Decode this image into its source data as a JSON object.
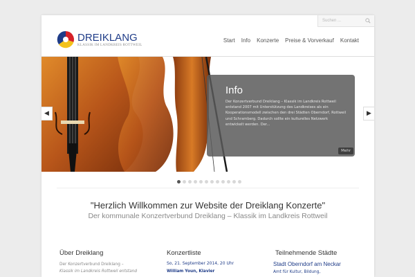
{
  "search": {
    "placeholder": "Suchen ..."
  },
  "logo": {
    "name": "DREIKLANG",
    "subtitle": "KLASSIK IM LANDKREIS ROTTWEIL"
  },
  "nav": [
    "Start",
    "Info",
    "Konzerte",
    "Preise & Vorverkauf",
    "Kontakt"
  ],
  "slider": {
    "title": "Info",
    "text": "Der Konzertverbund Dreiklang – Klassik im Landkreis Rottweil entstand 2007 mit Unterstützung des Landkreises als ein Kooperationsmodell zwischen den drei Städten Oberndorf, Rottweil und Schramberg. Dadurch sollte ein kulturelles Netzwerk entwickelt werden. Der...",
    "more": "Mehr",
    "dots_total": 12,
    "active_dot": 0
  },
  "welcome": {
    "headline": "\"Herzlich Willkommen zur Website der Dreiklang Konzerte\"",
    "subheadline": "Der kommunale Konzertverbund Dreiklang – Klassik im Landkreis Rottweil"
  },
  "columns": {
    "about": {
      "title": "Über Dreiklang",
      "line1": "Der Konzertverbund Dreiklang –",
      "line2": "Klassik im Landkreis Rottweil entstand"
    },
    "concerts": {
      "title": "Konzertliste",
      "date": "So, 21. September 2014, 20 Uhr",
      "artist": "William Youn, Klavier"
    },
    "cities": {
      "title": "Teilnehmende Städte",
      "town": "Stadt Oberndorf am Neckar",
      "line": "Amt für Kultur, Bildung,"
    }
  },
  "colors": {
    "brand_blue": "#1f3c88",
    "logo_red": "#d62128",
    "logo_yellow": "#f3c21b"
  }
}
